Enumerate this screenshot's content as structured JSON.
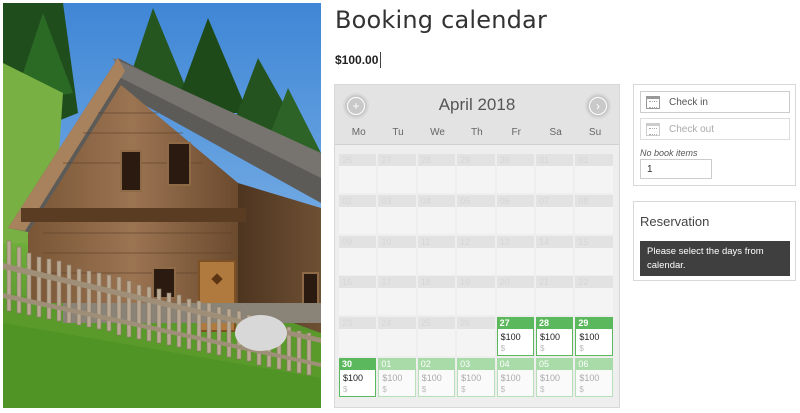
{
  "photo": {
    "alt": "cabin-photo"
  },
  "header": {
    "title": "Booking calendar",
    "price": "$100.00"
  },
  "calendar": {
    "month": "April 2018",
    "prev_icon": "plus-circle-icon",
    "next_icon": "chevron-right-circle-icon",
    "weekdays": [
      "Mo",
      "Tu",
      "We",
      "Th",
      "Fr",
      "Sa",
      "Su"
    ],
    "weeks": [
      [
        {
          "day": "26",
          "state": "disabled"
        },
        {
          "day": "27",
          "state": "disabled"
        },
        {
          "day": "28",
          "state": "disabled"
        },
        {
          "day": "29",
          "state": "disabled"
        },
        {
          "day": "30",
          "state": "disabled"
        },
        {
          "day": "31",
          "state": "disabled"
        },
        {
          "day": "01",
          "state": "disabled"
        }
      ],
      [
        {
          "day": "02",
          "state": "disabled"
        },
        {
          "day": "03",
          "state": "disabled"
        },
        {
          "day": "04",
          "state": "disabled"
        },
        {
          "day": "05",
          "state": "disabled"
        },
        {
          "day": "06",
          "state": "disabled"
        },
        {
          "day": "07",
          "state": "disabled"
        },
        {
          "day": "08",
          "state": "disabled"
        }
      ],
      [
        {
          "day": "09",
          "state": "disabled"
        },
        {
          "day": "10",
          "state": "disabled"
        },
        {
          "day": "11",
          "state": "disabled"
        },
        {
          "day": "12",
          "state": "disabled"
        },
        {
          "day": "13",
          "state": "disabled"
        },
        {
          "day": "14",
          "state": "disabled"
        },
        {
          "day": "15",
          "state": "disabled"
        }
      ],
      [
        {
          "day": "16",
          "state": "disabled"
        },
        {
          "day": "17",
          "state": "disabled"
        },
        {
          "day": "18",
          "state": "disabled"
        },
        {
          "day": "19",
          "state": "disabled"
        },
        {
          "day": "20",
          "state": "disabled"
        },
        {
          "day": "21",
          "state": "disabled"
        },
        {
          "day": "22",
          "state": "disabled"
        }
      ],
      [
        {
          "day": "23",
          "state": "disabled"
        },
        {
          "day": "24",
          "state": "disabled"
        },
        {
          "day": "25",
          "state": "disabled"
        },
        {
          "day": "26",
          "state": "disabled"
        },
        {
          "day": "27",
          "state": "available",
          "price": "$100",
          "currency": "$"
        },
        {
          "day": "28",
          "state": "available",
          "price": "$100",
          "currency": "$"
        },
        {
          "day": "29",
          "state": "available",
          "price": "$100",
          "currency": "$"
        }
      ],
      [
        {
          "day": "30",
          "state": "available",
          "price": "$100",
          "currency": "$"
        },
        {
          "day": "01",
          "state": "next-month",
          "price": "$100",
          "currency": "$"
        },
        {
          "day": "02",
          "state": "next-month",
          "price": "$100",
          "currency": "$"
        },
        {
          "day": "03",
          "state": "next-month",
          "price": "$100",
          "currency": "$"
        },
        {
          "day": "04",
          "state": "next-month",
          "price": "$100",
          "currency": "$"
        },
        {
          "day": "05",
          "state": "next-month",
          "price": "$100",
          "currency": "$"
        },
        {
          "day": "06",
          "state": "next-month",
          "price": "$100",
          "currency": "$"
        }
      ]
    ]
  },
  "form": {
    "check_in": "Check in",
    "check_out": "Check out",
    "book_items_label": "No book items",
    "book_items_value": "1",
    "calendar_icon": "calendar-icon"
  },
  "reservation": {
    "title": "Reservation",
    "message": "Please select the days from calendar."
  },
  "colors": {
    "available": "#5cb85c",
    "next_month": "#a9dba9",
    "message_bg": "#3f3f3f"
  }
}
